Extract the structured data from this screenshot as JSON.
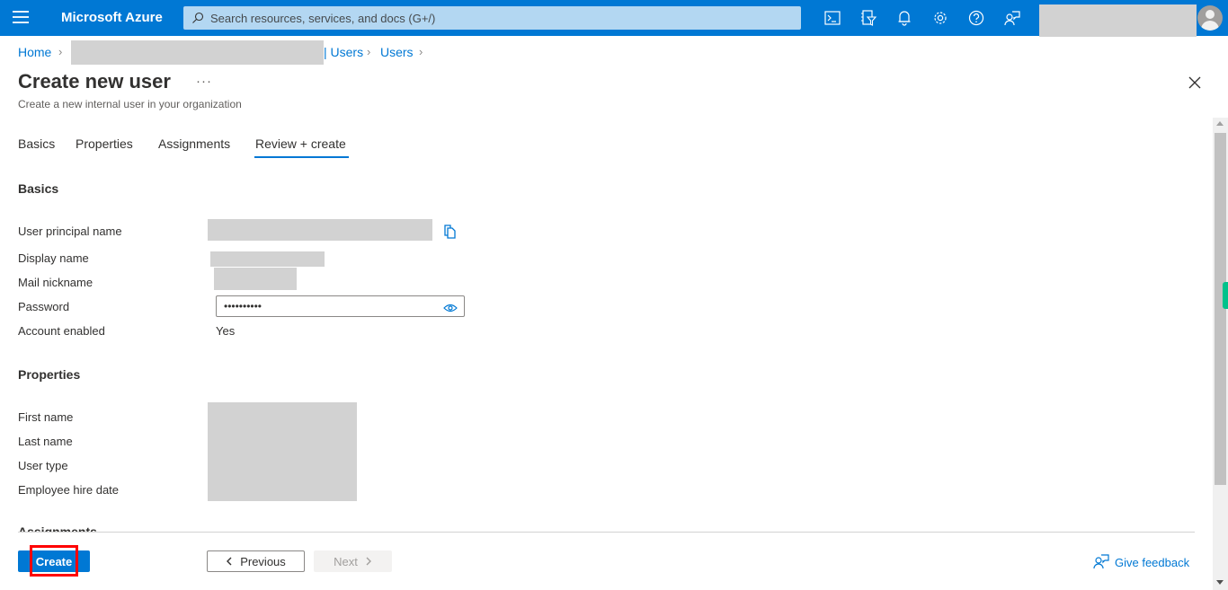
{
  "topbar": {
    "brand": "Microsoft Azure",
    "search_placeholder": "Search resources, services, and docs (G+/)",
    "icons": [
      "cloud-shell-icon",
      "directory-filter-icon",
      "notifications-icon",
      "settings-icon",
      "help-icon",
      "feedback-icon"
    ]
  },
  "breadcrumb": {
    "items": [
      "Home",
      "| Users",
      "Users"
    ]
  },
  "page": {
    "title": "Create new user",
    "more_label": "···",
    "subtitle": "Create a new internal user in your organization"
  },
  "tabs": [
    {
      "label": "Basics",
      "active": false
    },
    {
      "label": "Properties",
      "active": false
    },
    {
      "label": "Assignments",
      "active": false
    },
    {
      "label": "Review + create",
      "active": true
    }
  ],
  "basics": {
    "heading": "Basics",
    "fields": {
      "upn_label": "User principal name",
      "display_name_label": "Display name",
      "mail_nickname_label": "Mail nickname",
      "password_label": "Password",
      "password_value": "••••••••••",
      "account_enabled_label": "Account enabled",
      "account_enabled_value": "Yes"
    }
  },
  "properties": {
    "heading": "Properties",
    "fields": {
      "first_name_label": "First name",
      "last_name_label": "Last name",
      "user_type_label": "User type",
      "hire_date_label": "Employee hire date"
    }
  },
  "assignments": {
    "heading": "Assignments"
  },
  "footer": {
    "create_label": "Create",
    "previous_label": "Previous",
    "next_label": "Next",
    "feedback_label": "Give feedback"
  },
  "colors": {
    "accent": "#0078d4",
    "highlight": "#ff0000",
    "redaction": "#d2d2d2"
  }
}
